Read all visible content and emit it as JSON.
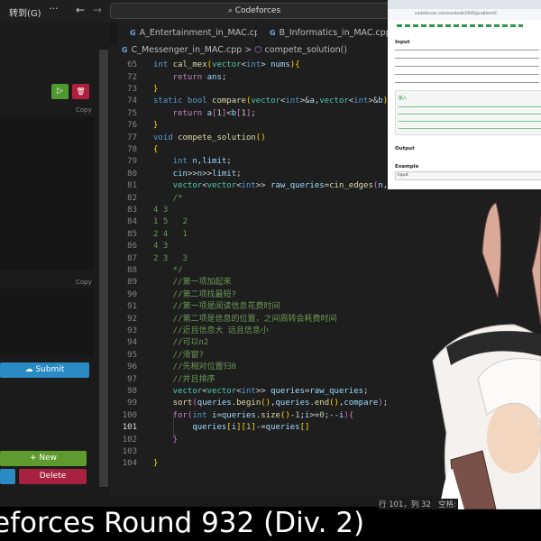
{
  "topbar": {
    "goto": "转到(G)",
    "more": "···",
    "back": "←",
    "forward": "→",
    "search": "⌕ Codeforces"
  },
  "tabs": [
    {
      "icon": "G",
      "label": "A_Entertainment_in_MAC.cpp"
    },
    {
      "icon": "G",
      "label": "B_Informatics_in_MAC.cpp"
    }
  ],
  "breadcrumb": {
    "icon": "G",
    "file": "C_Messenger_in_MAC.cpp",
    "sep": ">",
    "symbol_icon": "⬡",
    "symbol": "compete_solution()"
  },
  "left_panel": {
    "run": "▷",
    "delete_icon": "🗑",
    "copy1": "Copy",
    "copy2": "Copy",
    "submit": "Submit",
    "submit_icon": "☁",
    "new": "+ New",
    "delete": "Delete"
  },
  "code": [
    {
      "n": "65",
      "t": [
        [
          "int ",
          "kw"
        ],
        [
          "cal_mex",
          "fn"
        ],
        [
          "(",
          "br"
        ],
        [
          "vector",
          "ty"
        ],
        [
          "<",
          "d"
        ],
        [
          "int",
          "kw"
        ],
        [
          "> ",
          "d"
        ],
        [
          "nums",
          "va"
        ],
        [
          ")",
          "br"
        ],
        [
          "{",
          "br"
        ]
      ]
    },
    {
      "n": "72",
      "t": [
        [
          "    return ",
          "ct"
        ],
        [
          "ans",
          "va"
        ],
        [
          ";",
          "d"
        ]
      ]
    },
    {
      "n": "73",
      "t": [
        [
          "}",
          "br"
        ]
      ]
    },
    {
      "n": "74",
      "t": [
        [
          "static bool ",
          "kw"
        ],
        [
          "compare",
          "fn"
        ],
        [
          "(",
          "br"
        ],
        [
          "vector",
          "ty"
        ],
        [
          "<",
          "d"
        ],
        [
          "int",
          "kw"
        ],
        [
          ">&",
          "d"
        ],
        [
          "a",
          "va"
        ],
        [
          ",",
          "d"
        ],
        [
          "vector",
          "ty"
        ],
        [
          "<",
          "d"
        ],
        [
          "int",
          "kw"
        ],
        [
          ">&",
          "d"
        ],
        [
          "b",
          "va"
        ],
        [
          ")",
          "br"
        ],
        [
          "{",
          "br"
        ]
      ]
    },
    {
      "n": "75",
      "t": [
        [
          "    return ",
          "ct"
        ],
        [
          "a",
          "va"
        ],
        [
          "[",
          "br2"
        ],
        [
          "1",
          "nu"
        ],
        [
          "]",
          "br2"
        ],
        [
          "<",
          "d"
        ],
        [
          "b",
          "va"
        ],
        [
          "[",
          "br2"
        ],
        [
          "1",
          "nu"
        ],
        [
          "]",
          "br2"
        ],
        [
          ";",
          "d"
        ]
      ]
    },
    {
      "n": "76",
      "t": [
        [
          "}",
          "br"
        ]
      ]
    },
    {
      "n": "77",
      "t": [
        [
          "void ",
          "kw"
        ],
        [
          "compete_solution",
          "fn"
        ],
        [
          "()",
          "br"
        ]
      ]
    },
    {
      "n": "78",
      "t": [
        [
          "{",
          "br"
        ]
      ]
    },
    {
      "n": "79",
      "t": [
        [
          "    int ",
          "kw"
        ],
        [
          "n",
          "va"
        ],
        [
          ",",
          "d"
        ],
        [
          "limit",
          "va"
        ],
        [
          ";",
          "d"
        ]
      ]
    },
    {
      "n": "80",
      "t": [
        [
          "    cin",
          "va"
        ],
        [
          ">>",
          "d"
        ],
        [
          "n",
          "va"
        ],
        [
          ">>",
          "d"
        ],
        [
          "limit",
          "va"
        ],
        [
          ";",
          "d"
        ]
      ]
    },
    {
      "n": "81",
      "t": [
        [
          "    vector",
          "ty"
        ],
        [
          "<",
          "d"
        ],
        [
          "vector",
          "ty"
        ],
        [
          "<",
          "d"
        ],
        [
          "int",
          "kw"
        ],
        [
          ">> ",
          "d"
        ],
        [
          "raw_queries",
          "va"
        ],
        [
          "=",
          "d"
        ],
        [
          "cin_edges",
          "fn"
        ],
        [
          "(",
          "br2"
        ],
        [
          "n",
          "va"
        ],
        [
          ",",
          "d"
        ],
        [
          "2",
          "nu"
        ],
        [
          ")",
          "br2"
        ],
        [
          ";",
          "d"
        ]
      ]
    },
    {
      "n": "82",
      "t": [
        [
          "    /*",
          "cm"
        ]
      ]
    },
    {
      "n": "83",
      "t": [
        [
          "4 3",
          "cm"
        ]
      ]
    },
    {
      "n": "84",
      "t": [
        [
          "1 5   2",
          "cm"
        ]
      ]
    },
    {
      "n": "85",
      "t": [
        [
          "2 4   1",
          "cm"
        ]
      ]
    },
    {
      "n": "86",
      "t": [
        [
          "4 3",
          "cm"
        ]
      ]
    },
    {
      "n": "87",
      "t": [
        [
          "2 3   3",
          "cm"
        ]
      ]
    },
    {
      "n": "88",
      "t": [
        [
          "    */",
          "cm"
        ]
      ]
    },
    {
      "n": "89",
      "t": [
        [
          "    //第一项加起来",
          "cm"
        ]
      ]
    },
    {
      "n": "90",
      "t": [
        [
          "    //第二项找最短?",
          "cm"
        ]
      ]
    },
    {
      "n": "91",
      "t": [
        [
          "    //第一项是阅读信息花费时间",
          "cm"
        ]
      ]
    },
    {
      "n": "92",
      "t": [
        [
          "    //第二项是信息的位置，之间周转会耗费时间",
          "cm"
        ]
      ]
    },
    {
      "n": "93",
      "t": [
        [
          "    //近且信息大 远且信息小",
          "cm"
        ]
      ]
    },
    {
      "n": "94",
      "t": [
        [
          "    //可以n2",
          "cm"
        ]
      ]
    },
    {
      "n": "95",
      "t": [
        [
          "    //滑窗?",
          "cm"
        ]
      ]
    },
    {
      "n": "96",
      "t": [
        [
          "    //先相对位置归0",
          "cm"
        ]
      ]
    },
    {
      "n": "97",
      "t": [
        [
          "    //并且排序",
          "cm"
        ]
      ]
    },
    {
      "n": "98",
      "t": [
        [
          "    vector",
          "ty"
        ],
        [
          "<",
          "d"
        ],
        [
          "vector",
          "ty"
        ],
        [
          "<",
          "d"
        ],
        [
          "int",
          "kw"
        ],
        [
          ">> ",
          "d"
        ],
        [
          "queries",
          "va"
        ],
        [
          "=",
          "d"
        ],
        [
          "raw_queries",
          "va"
        ],
        [
          ";",
          "d"
        ]
      ]
    },
    {
      "n": "99",
      "t": [
        [
          "    sort",
          "fn"
        ],
        [
          "(",
          "br2"
        ],
        [
          "queries",
          "va"
        ],
        [
          ".",
          "d"
        ],
        [
          "begin",
          "fn"
        ],
        [
          "()",
          "br"
        ],
        [
          ",",
          "d"
        ],
        [
          "queries",
          "va"
        ],
        [
          ".",
          "d"
        ],
        [
          "end",
          "fn"
        ],
        [
          "()",
          "br"
        ],
        [
          ",",
          "d"
        ],
        [
          "compare",
          "va"
        ],
        [
          ")",
          "br2"
        ],
        [
          ";",
          "d"
        ]
      ]
    },
    {
      "n": "100",
      "t": [
        [
          "    for",
          "ct"
        ],
        [
          "(",
          "br2"
        ],
        [
          "int ",
          "kw"
        ],
        [
          "i",
          "va"
        ],
        [
          "=",
          "d"
        ],
        [
          "queries",
          "va"
        ],
        [
          ".",
          "d"
        ],
        [
          "size",
          "fn"
        ],
        [
          "()",
          "br"
        ],
        [
          "-",
          "d"
        ],
        [
          "1",
          "nu"
        ],
        [
          ";",
          "d"
        ],
        [
          "i",
          "va"
        ],
        [
          ">=",
          "d"
        ],
        [
          "0",
          "nu"
        ],
        [
          ";--",
          "d"
        ],
        [
          "i",
          "va"
        ],
        [
          ")",
          "br2"
        ],
        [
          "{",
          "br2"
        ]
      ]
    },
    {
      "n": "101",
      "t": [
        [
          "        queries",
          "va"
        ],
        [
          "[",
          "br"
        ],
        [
          "i",
          "va"
        ],
        [
          "]",
          "br"
        ],
        [
          "[",
          "br"
        ],
        [
          "1",
          "nu"
        ],
        [
          "]",
          "br"
        ],
        [
          "-=",
          "d"
        ],
        [
          "queries",
          "va"
        ],
        [
          "[]",
          "br"
        ]
      ]
    },
    {
      "n": "102",
      "t": [
        [
          "    }",
          "br2"
        ]
      ]
    },
    {
      "n": "103",
      "t": [
        [
          "",
          "d"
        ]
      ]
    },
    {
      "n": "104",
      "t": [
        [
          "}",
          "br"
        ]
      ]
    }
  ],
  "status": {
    "position": "行 101，列 32",
    "spaces": "空格:"
  },
  "subtitle": "eforces Round 932 (Div. 2)",
  "browser": {
    "url": "codeforces.com/contest/1935/problem/C",
    "input_heading": "Input",
    "output_heading": "Output",
    "example_heading": "Example",
    "example_input": "Input",
    "translate_label": "输入"
  }
}
